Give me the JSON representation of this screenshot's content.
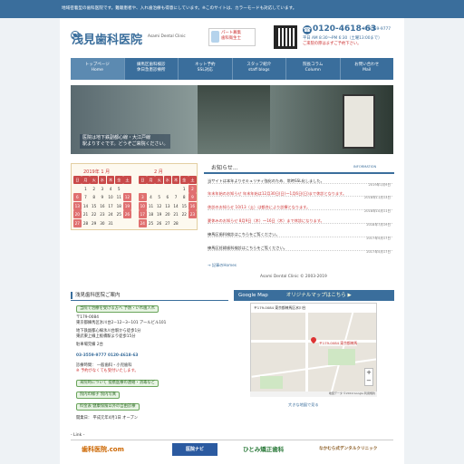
{
  "top_strip": "地域密着型の歯科医院です。難聴患者や、入れ歯治療も得意にしています。※このサイトは、カラーモードも対応しています。",
  "brand": {
    "name": "浅見歯科医院",
    "en": "Asami Dental Clinic"
  },
  "badge": {
    "line1": "パート募集",
    "line2": "歯科衛生士"
  },
  "contact": {
    "phone": "0120-4618-63",
    "alt_phone": "03-3559-9777",
    "hours": "平日 AM 8:30〜PM 6:30（土曜13:00まで）",
    "note": "ご来院の際はまずご予約下さい。"
  },
  "nav": [
    {
      "jp": "トップページ",
      "en": "Home"
    },
    {
      "jp": "練馬区歯科検診",
      "en": "休日急患診療所"
    },
    {
      "jp": "ネット予約",
      "en": "SSL対応"
    },
    {
      "jp": "スタッフ紹介",
      "en": "staff blogs"
    },
    {
      "jp": "院長コラム",
      "en": "Column"
    },
    {
      "jp": "お問い合わせ",
      "en": "Mail"
    }
  ],
  "hero": {
    "caption1": "医院は地下鉄副都心線・大江戸線",
    "caption2": "駅よりすぐです。どうぞご来院ください。"
  },
  "calendar": {
    "jan_title": "2019年 1 月",
    "feb_title": "2 月",
    "jan": [
      [
        "日",
        "月",
        "火",
        "水",
        "木",
        "金",
        "土"
      ],
      [
        "",
        "1",
        "2",
        "3",
        "4",
        "5"
      ],
      [
        "6",
        "7",
        "8",
        "9",
        "10",
        "11",
        "12"
      ],
      [
        "13",
        "14",
        "15",
        "16",
        "17",
        "18",
        "19"
      ],
      [
        "20",
        "21",
        "22",
        "23",
        "24",
        "25",
        "26"
      ],
      [
        "27",
        "28",
        "29",
        "30",
        "31",
        "",
        ""
      ]
    ],
    "feb": [
      [
        "日",
        "月",
        "火",
        "水",
        "木",
        "金",
        "土"
      ],
      [
        "",
        "",
        "",
        "",
        "",
        "1",
        "2"
      ],
      [
        "3",
        "4",
        "5",
        "6",
        "7",
        "8",
        "9"
      ],
      [
        "10",
        "11",
        "12",
        "13",
        "14",
        "15",
        "16"
      ],
      [
        "17",
        "18",
        "19",
        "20",
        "21",
        "22",
        "23"
      ],
      [
        "24",
        "25",
        "26",
        "27",
        "28",
        "",
        ""
      ]
    ]
  },
  "news": {
    "title": "お知らせ...",
    "info_label": "INFORMATION",
    "items": [
      {
        "text": "当サイトは本年よりセキュリティ強化のため、常時SSL化しました。",
        "date": "2019年1月9日"
      },
      {
        "text": "年末年始のお知らせ  年末年始は12月30日(日)〜1月6日(日)まで休診となります。",
        "date": "2018年11月13日"
      },
      {
        "text": "休診のお知らせ  10/13（土）は都合により診療となります。",
        "date": "2018年10月11日"
      },
      {
        "text": "夏休みのお知らせ  8月9日（木）〜16日（木）まで休診になります。",
        "date": "2018年7月19日"
      },
      {
        "text": "練馬区歯科検診はこちらをご覧ください。",
        "date": "2017年5月17日"
      },
      {
        "text": "練馬区妊婦歯科検診はこちらをご覧ください。",
        "date": "2017年5月17日"
      }
    ],
    "more": "→ 記事のHomes",
    "copyright": "Asami Dental Clinic © 2003-2019"
  },
  "info": {
    "title": "浅見歯科医院ご案内",
    "rows": [
      "当院で治療を受ける方へ  予防・いれ歯入れ",
      "〒179-0084",
      "東京都練馬区氷川台2−12−3−101  アールビル101",
      "地下鉄副都心線氷川台駅から徒歩1分",
      "東武東上線上板橋駅より徒歩15分",
      "駐車場完備 2台",
      "03-3559-9777  0120-4618-63",
      "診療時間：  一般歯科・小児歯科",
      "※ 予約がなくても受付いたします。",
      "来院時について  提携医療の連絡・消毒など",
      "院内の様子  院内写真",
      "料金表  健康保険以外の自由診療",
      "開業日：  平成元年4月1日  オープン"
    ]
  },
  "map": {
    "title": "Google Map",
    "link": "オリジナルマップはこちら ▶",
    "address": "〒179-0084 東京都練馬区氷川台",
    "pin_label": "〒179-0084 東京都練馬",
    "big_map": "大きな地図で見る",
    "footer": "地図データ ©2019 Google 利用規約"
  },
  "links": {
    "title": "- Link -",
    "banners": [
      "歯科医院.com",
      "医院ナビ",
      "ひとみ矯正歯科",
      "なかむら式デンタルクリニック"
    ]
  }
}
